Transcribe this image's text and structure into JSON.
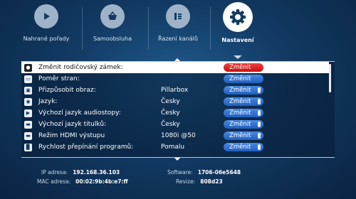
{
  "tabs": [
    {
      "label": "Nahrané pořady",
      "icon": "play-icon"
    },
    {
      "label": "Samoobsluha",
      "icon": "basket-icon"
    },
    {
      "label": "Řazení kanálů",
      "icon": "channel-order-icon"
    },
    {
      "label": "Nastavení",
      "icon": "gear-icon",
      "active": true
    }
  ],
  "settings": [
    {
      "icon": "lock-icon",
      "label": "Změnit rodičovský zámek:",
      "value": "",
      "button": "Změnit",
      "selected": true
    },
    {
      "icon": "aspect-ratio-icon",
      "label": "Poměr stran:",
      "value": "",
      "button": "Změnit"
    },
    {
      "icon": "picture-fit-icon",
      "label": "Přizpůsobit obraz:",
      "value": "Pillarbox",
      "button": "Změnit"
    },
    {
      "icon": "language-icon",
      "label": "Jazyk:",
      "value": "Česky",
      "button": "Změnit"
    },
    {
      "icon": "speaker-icon",
      "label": "Výchozí jazyk audiostopy:",
      "value": "Česky",
      "button": "Změnit"
    },
    {
      "icon": "subtitles-icon",
      "label": "Výchozí jazyk titulků:",
      "value": "Česky",
      "button": "Změnit"
    },
    {
      "icon": "hdmi-icon",
      "label": "Režim HDMI výstupu",
      "value": "1080i @50",
      "button": "Změnit"
    },
    {
      "icon": "signal-bars-icon",
      "label": "Rychlost přepínání programů:",
      "value": "Pomalu",
      "button": "Změnit"
    }
  ],
  "info": {
    "ip_label": "IP adresa:",
    "ip_value": "192.168.36.103",
    "mac_label": "MAC adresa:",
    "mac_value": "00:02:9b:4b:e7:ff",
    "software_label": "Software:",
    "software_value": "1706-06e5648",
    "revision_label": "Revize:",
    "revision_value": "808d23"
  },
  "colors": {
    "accent_blue": "#1f5fc0",
    "selected_red": "#d01818",
    "background": "#123a63"
  }
}
